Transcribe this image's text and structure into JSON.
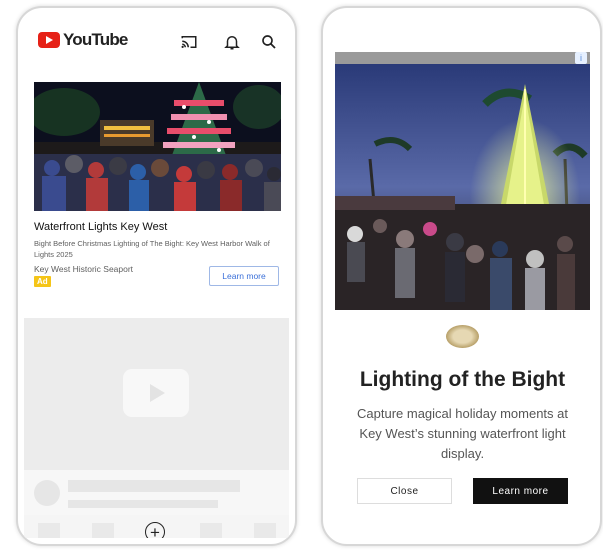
{
  "youtube_app": {
    "header": {
      "logo_text": "YouTube",
      "icons": [
        "cast-icon",
        "bell-icon",
        "search-icon"
      ]
    },
    "ad": {
      "title": "Waterfront Lights Key West",
      "description": "Bight Before Christmas Lighting of The Bight: Key West Harbor Walk of Lights 2025",
      "advertiser": "Key West Historic Seaport",
      "badge": "Ad",
      "cta": "Learn more"
    },
    "bottom_nav": {
      "add_symbol": "+"
    }
  },
  "interstitial_ad": {
    "info_symbol": "i",
    "title": "Lighting of the Bight",
    "body": "Capture magical holiday moments at Key West’s stunning waterfront light display.",
    "close_label": "Close",
    "cta": "Learn more"
  },
  "colors": {
    "youtube_red": "#e62117",
    "ad_badge": "#f5c518",
    "link_blue": "#3a6fd8",
    "cta_dark": "#111111"
  }
}
